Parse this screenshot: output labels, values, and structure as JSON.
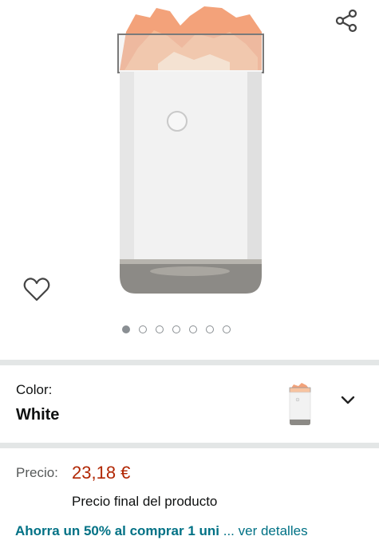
{
  "gallery": {
    "image": "salt-lamp-humidifier-white",
    "total_images": 7,
    "active_index": 0
  },
  "icons": {
    "share": "share-icon",
    "wishlist": "heart-icon",
    "expand": "chevron-down-icon"
  },
  "variation": {
    "label": "Color:",
    "value": "White"
  },
  "price": {
    "label": "Precio:",
    "amount": "23,18 €",
    "note": "Precio final del producto",
    "color": "#b12704"
  },
  "promo": {
    "text": "Ahorra un 50% al comprar 1 uni",
    "more": " ... ver detalles",
    "color": "#007185"
  }
}
